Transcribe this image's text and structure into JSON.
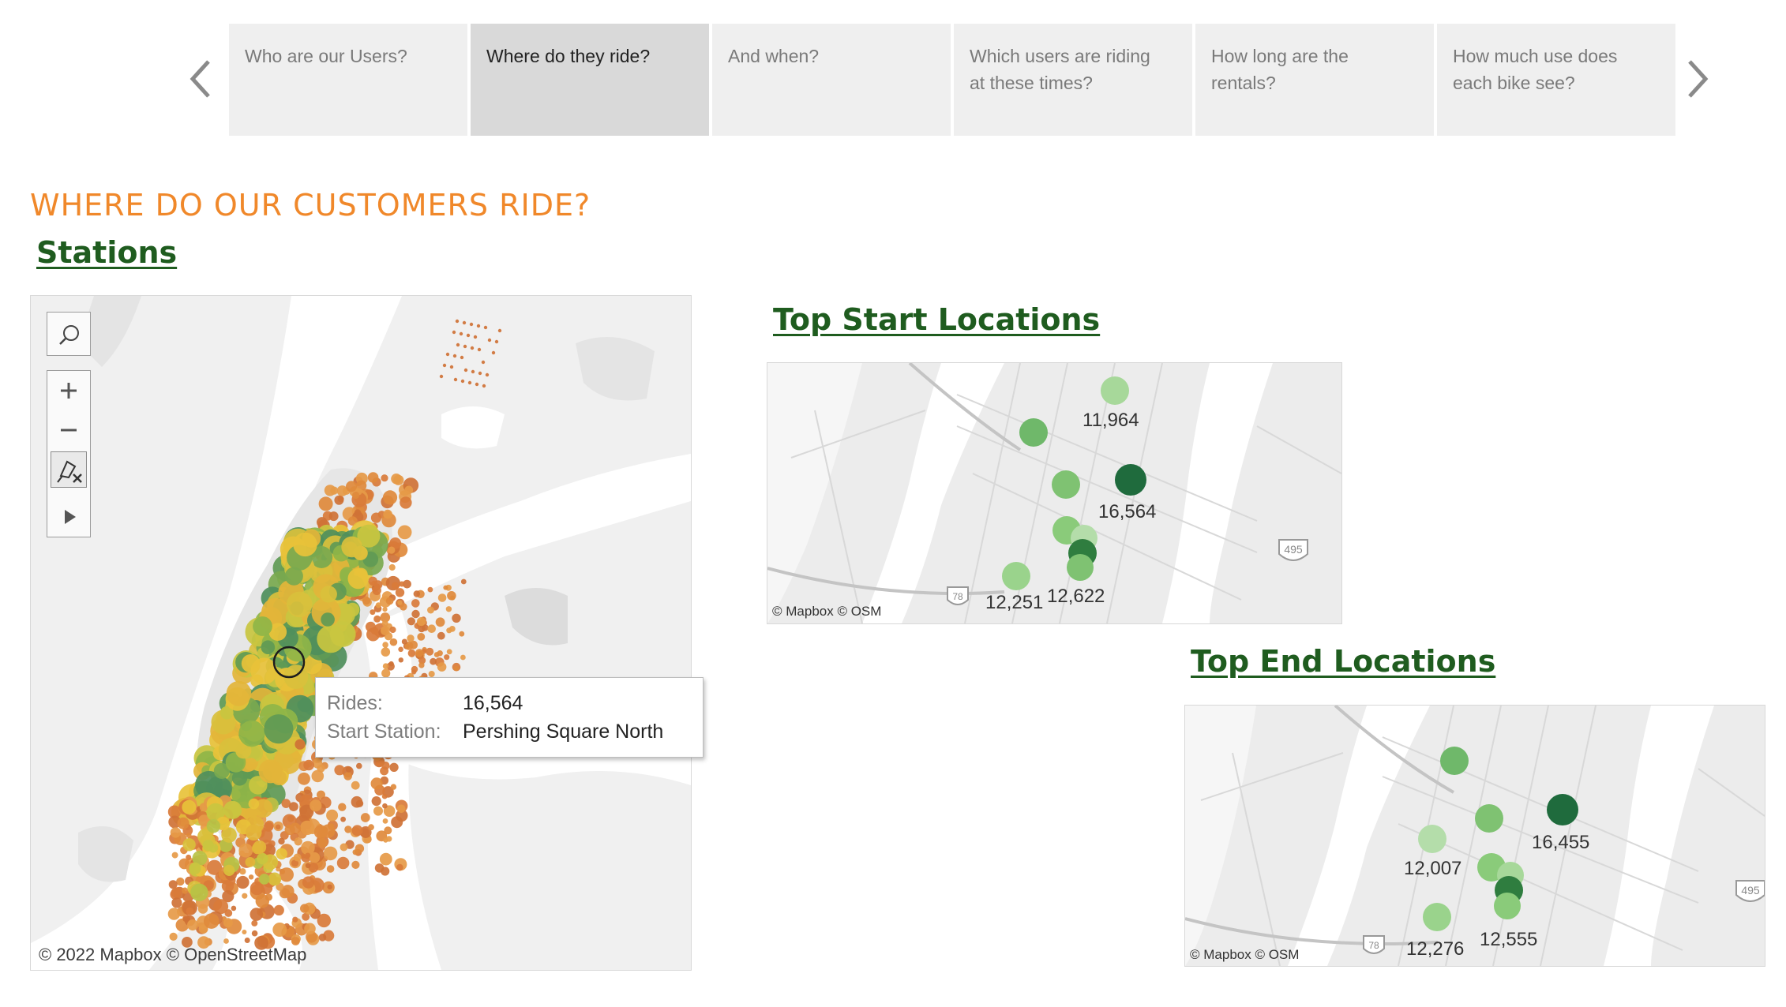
{
  "story_nav": {
    "prev_icon": "chevron-left-icon",
    "next_icon": "chevron-right-icon",
    "tabs": [
      {
        "line1": "Who are our Users?",
        "line2": ""
      },
      {
        "line1": "Where do they ride?",
        "line2": ""
      },
      {
        "line1": "And when?",
        "line2": ""
      },
      {
        "line1": "Which users are riding",
        "line2": "at these times?"
      },
      {
        "line1": "How long are the",
        "line2": "rentals?"
      },
      {
        "line1": "How much use does",
        "line2": "each bike see?"
      }
    ],
    "active_index": 1
  },
  "page": {
    "title": "WHERE DO OUR CUSTOMERS RIDE?",
    "colors": {
      "title": "#f0882a",
      "heading": "#1f5c1f"
    }
  },
  "stations_map": {
    "heading": "Stations",
    "credit": "© 2022 Mapbox © OpenStreetMap",
    "toolbar": {
      "search_icon": "search-icon",
      "zoom_in_icon": "plus-icon",
      "zoom_out_icon": "minus-icon",
      "reset_icon": "pin-reset-icon",
      "expand_icon": "triangle-right-icon"
    },
    "tooltip": {
      "rows": [
        {
          "key": "Rides:",
          "value": "16,564"
        },
        {
          "key": "Start Station:",
          "value": "Pershing Square North"
        }
      ]
    }
  },
  "top_start": {
    "heading": "Top Start Locations",
    "credit": "© Mapbox © OSM",
    "labels": [
      "11,964",
      "16,564",
      "12,251",
      "12,622"
    ],
    "shield": "495",
    "shield_small": "78"
  },
  "top_end": {
    "heading": "Top End Locations",
    "credit": "© Mapbox © OSM",
    "labels": [
      "16,455",
      "12,007",
      "12,276",
      "12,555"
    ],
    "shield": "495",
    "shield_small": "78"
  }
}
